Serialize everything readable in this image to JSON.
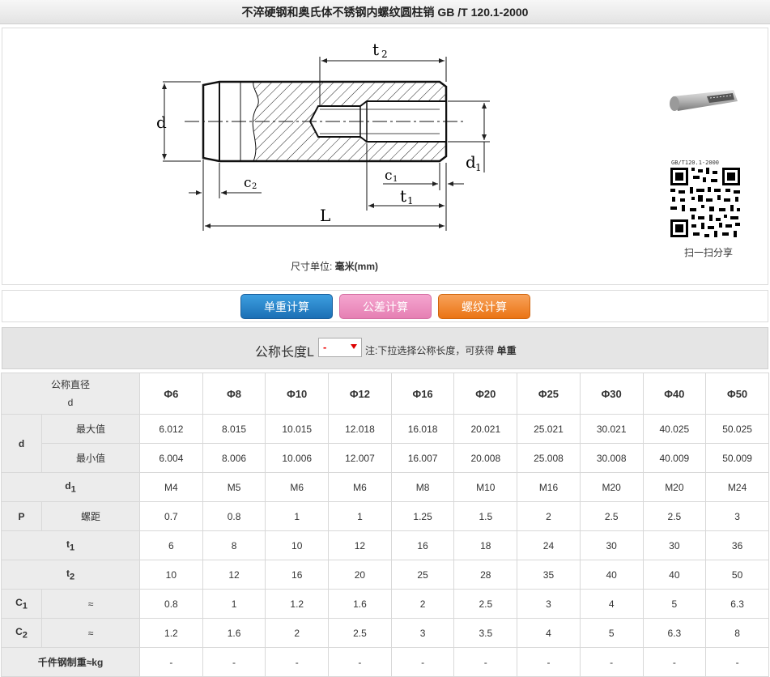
{
  "header": {
    "title": "不淬硬钢和奥氏体不锈钢内螺纹圆柱销 GB /T 120.1-2000"
  },
  "drawing": {
    "labels": {
      "d": "d",
      "t2": "t",
      "t2_sub": "2",
      "d1": "d",
      "d1_sub": "1",
      "c1": "c",
      "c1_sub": "1",
      "c2": "c",
      "c2_sub": "2",
      "t1": "t",
      "t1_sub": "1",
      "L": "L"
    },
    "unit_prefix": "尺寸单位: ",
    "unit_value": "毫米(mm)"
  },
  "share": {
    "qr_caption": "GB/T120.1-2000",
    "label": "扫一扫分享"
  },
  "buttons": {
    "weight": "单重计算",
    "tolerance": "公差计算",
    "thread": "螺纹计算"
  },
  "length_selector": {
    "label": "公称长度L",
    "selected": "-",
    "note_prefix": "注:下拉选择公称长度，可获得 ",
    "note_bold": "单重"
  },
  "table": {
    "header_label_1": "公称直径",
    "header_label_2": "d",
    "diameters": [
      "Φ6",
      "Φ8",
      "Φ10",
      "Φ12",
      "Φ16",
      "Φ20",
      "Φ25",
      "Φ30",
      "Φ40",
      "Φ50"
    ],
    "rows": [
      {
        "group": "d",
        "sub": "最大值",
        "values": [
          "6.012",
          "8.015",
          "10.015",
          "12.018",
          "16.018",
          "20.021",
          "25.021",
          "30.021",
          "40.025",
          "50.025"
        ]
      },
      {
        "group": "d",
        "sub": "最小值",
        "values": [
          "6.004",
          "8.006",
          "10.006",
          "12.007",
          "16.007",
          "20.008",
          "25.008",
          "30.008",
          "40.009",
          "50.009"
        ]
      },
      {
        "group": "d",
        "group_sub": "1",
        "values": [
          "M4",
          "M5",
          "M6",
          "M6",
          "M8",
          "M10",
          "M16",
          "M20",
          "M20",
          "M24"
        ]
      },
      {
        "group": "P",
        "sub": "螺距",
        "values": [
          "0.7",
          "0.8",
          "1",
          "1",
          "1.25",
          "1.5",
          "2",
          "2.5",
          "2.5",
          "3"
        ]
      },
      {
        "group": "t",
        "group_sub": "1",
        "values": [
          "6",
          "8",
          "10",
          "12",
          "16",
          "18",
          "24",
          "30",
          "30",
          "36"
        ]
      },
      {
        "group": "t",
        "group_sub": "2",
        "values": [
          "10",
          "12",
          "16",
          "20",
          "25",
          "28",
          "35",
          "40",
          "40",
          "50"
        ]
      },
      {
        "group": "C",
        "group_sub": "1",
        "sub": "≈",
        "values": [
          "0.8",
          "1",
          "1.2",
          "1.6",
          "2",
          "2.5",
          "3",
          "4",
          "5",
          "6.3"
        ]
      },
      {
        "group": "C",
        "group_sub": "2",
        "sub": "≈",
        "values": [
          "1.2",
          "1.6",
          "2",
          "2.5",
          "3",
          "3.5",
          "4",
          "5",
          "6.3",
          "8"
        ]
      },
      {
        "group": "千件钢制重≈kg",
        "values": [
          "-",
          "-",
          "-",
          "-",
          "-",
          "-",
          "-",
          "-",
          "-",
          "-"
        ]
      }
    ]
  }
}
